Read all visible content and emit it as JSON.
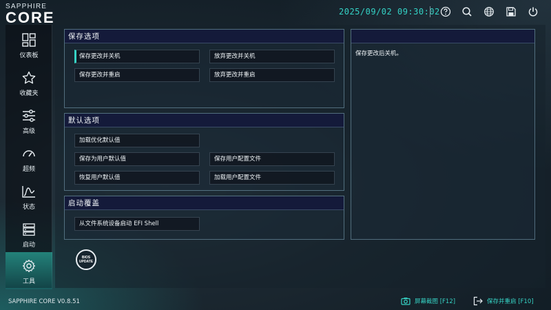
{
  "brand": {
    "top": "SAPPHIRE",
    "main": "CORE"
  },
  "header": {
    "datetime": "2025/09/02 09:30:02",
    "icons": [
      "help-icon",
      "search-icon",
      "language-icon",
      "save-icon",
      "power-icon"
    ]
  },
  "sidebar": {
    "items": [
      {
        "label": "仪表板",
        "icon": "dashboard-icon"
      },
      {
        "label": "收藏夹",
        "icon": "star-icon"
      },
      {
        "label": "高级",
        "icon": "sliders-icon"
      },
      {
        "label": "超频",
        "icon": "gauge-icon"
      },
      {
        "label": "状态",
        "icon": "chart-icon"
      },
      {
        "label": "启动",
        "icon": "boot-icon"
      },
      {
        "label": "工具",
        "icon": "gear-icon",
        "active": true
      }
    ]
  },
  "panels": {
    "save_options": {
      "title": "保存选项",
      "buttons": [
        "保存更改并关机",
        "放弃更改并关机",
        "保存更改并重启",
        "放弃更改并重启"
      ]
    },
    "default_options": {
      "title": "默认选项",
      "buttons": [
        "加载优化默认值",
        "保存为用户默认值",
        "保存用户配置文件",
        "恢复用户默认值",
        "加载用户配置文件"
      ]
    },
    "boot_override": {
      "title": "启动覆盖",
      "buttons": [
        "从文件系统设备启动 EFI Shell"
      ]
    },
    "description": {
      "text": "保存更改后关机。"
    }
  },
  "bios_update": {
    "line1": "BIOS",
    "line2": "UPDATE"
  },
  "footer": {
    "version": "SAPPHIRE CORE V0.8.51",
    "screenshot": "屏幕截图 [F12]",
    "save_reboot": "保存并重启 [F10]"
  },
  "colors": {
    "accent": "#36d2c4",
    "panel_title_bg": "#141a3a"
  }
}
